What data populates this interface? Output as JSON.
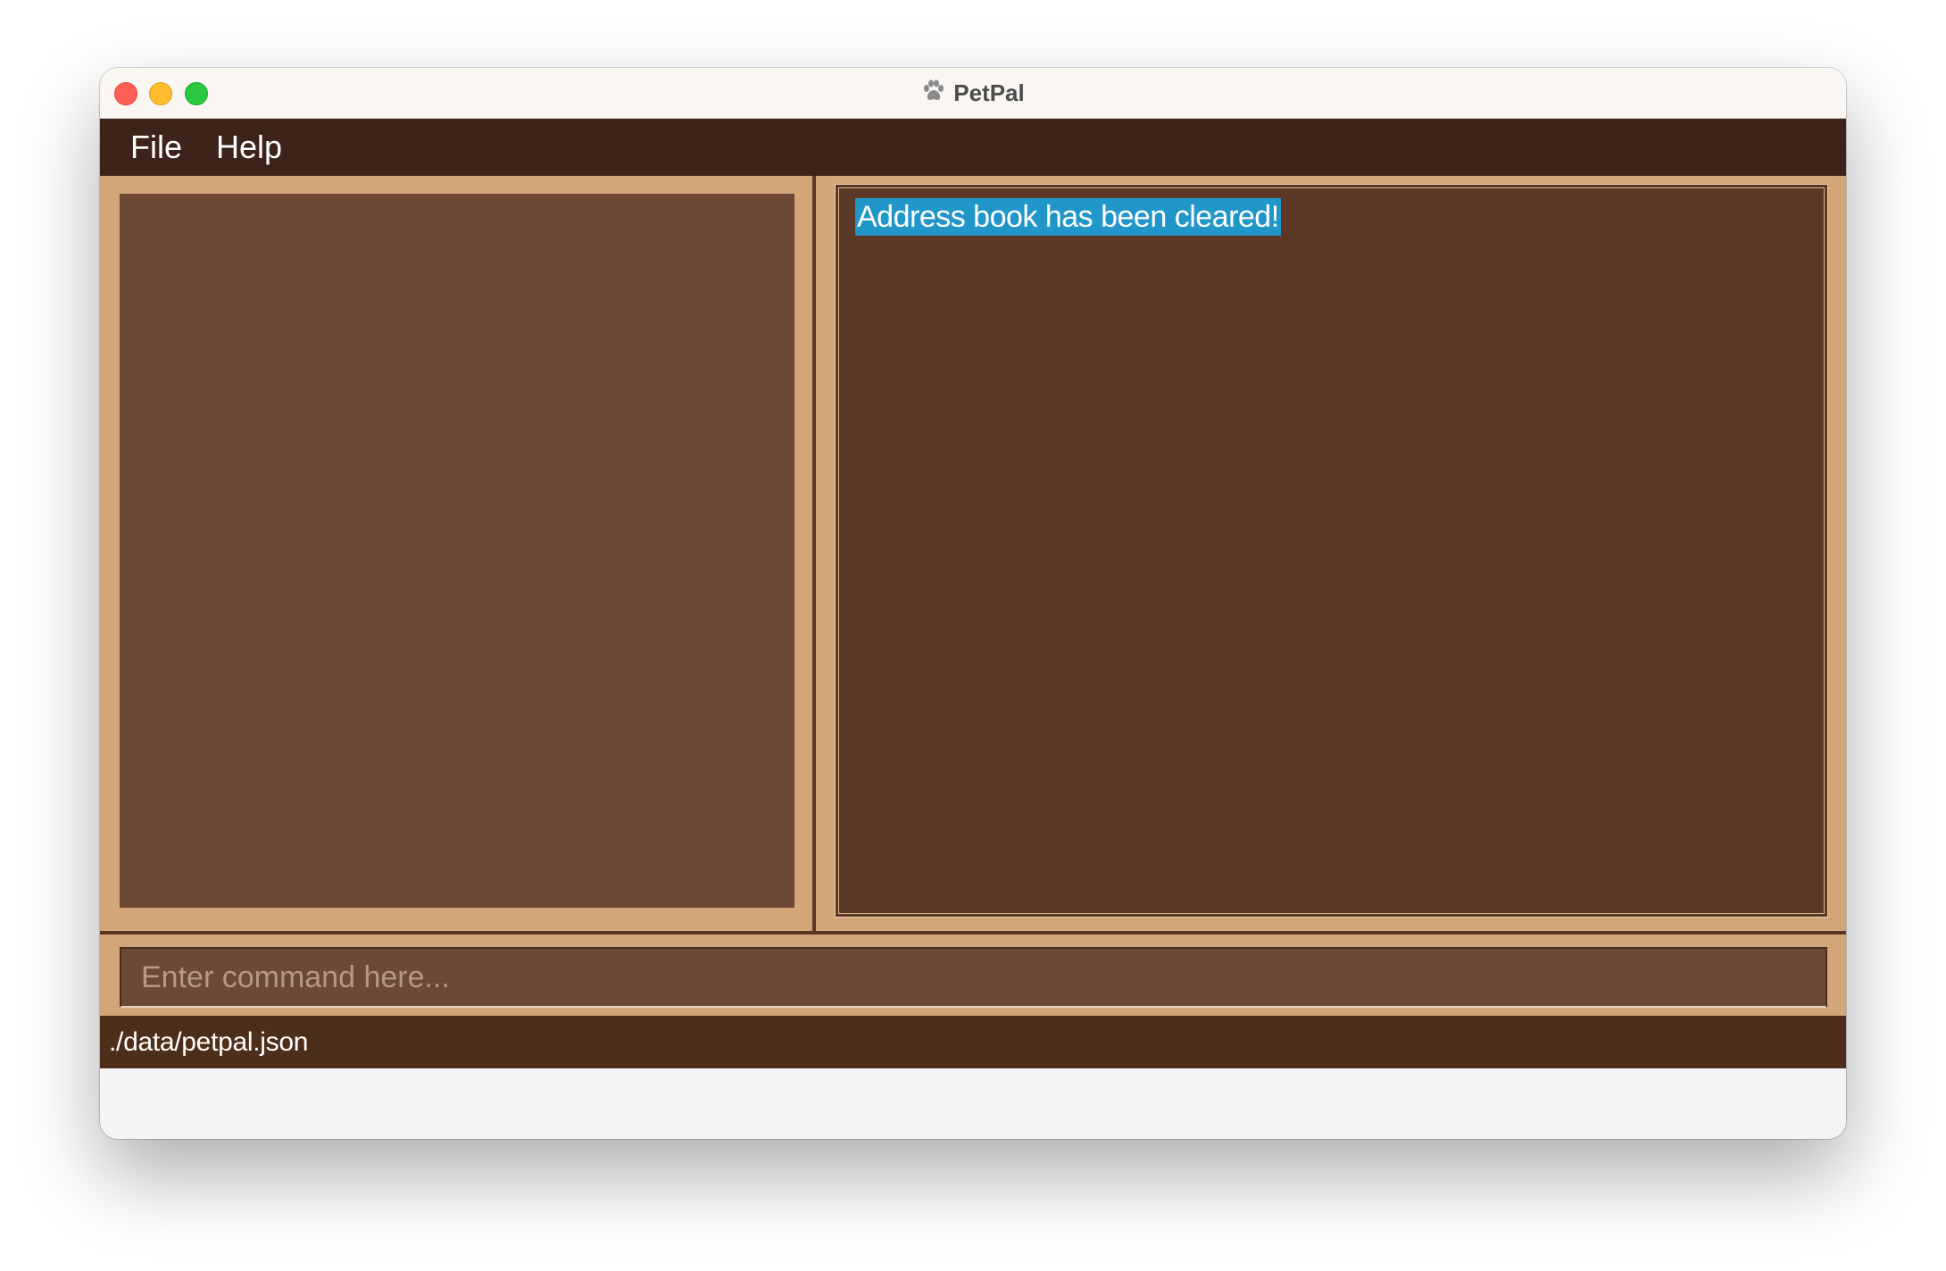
{
  "window": {
    "title": "PetPal",
    "icon": "paw-icon"
  },
  "menu": {
    "items": [
      {
        "label": "File"
      },
      {
        "label": "Help"
      }
    ]
  },
  "result": {
    "message": "Address book has been cleared!"
  },
  "command": {
    "placeholder": "Enter command here...",
    "value": ""
  },
  "status": {
    "file_path": "./data/petpal.json"
  },
  "colors": {
    "menubar": "#3d2319",
    "panel_bg": "#d2a679",
    "list_bg": "#6c4835",
    "result_bg": "#5b3726",
    "highlight": "#2196c8",
    "statusbar": "#4d2e1a"
  }
}
